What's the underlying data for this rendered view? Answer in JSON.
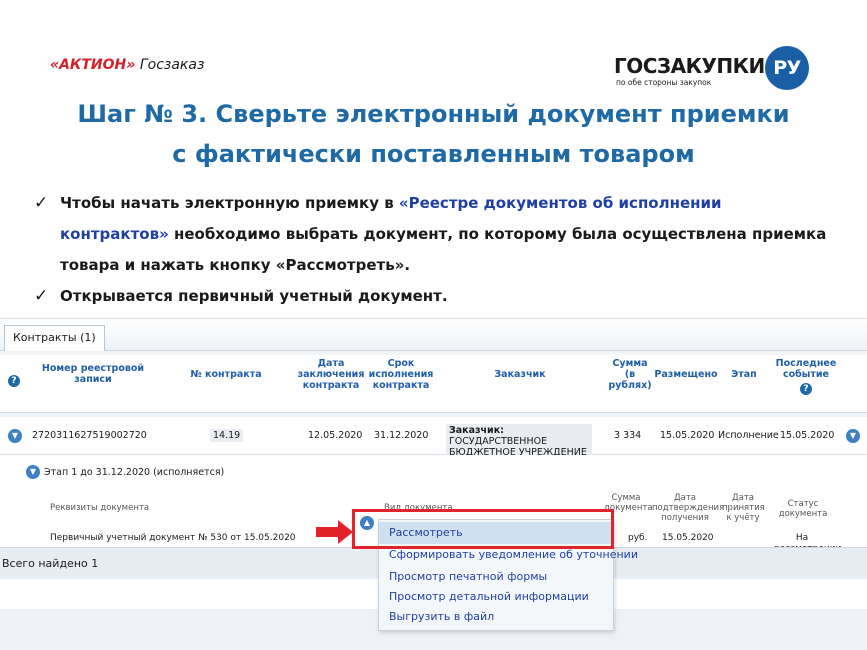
{
  "header": {
    "aktion_brand": "«АКТИОН»",
    "aktion_product": "Госзаказ",
    "gz_word": "ГОСЗАКУПКИ",
    "gz_circle": "РУ",
    "gz_tagline": "по обе стороны закупок"
  },
  "title": {
    "line1": "Шаг № 3. Сверьте электронный документ приемки",
    "line2": "с фактически поставленным товаром"
  },
  "bullets": {
    "b1_part1": "Чтобы начать электронную приемку в ",
    "b1_link": "«Реестре документов об исполнении контрактов»",
    "b1_part2": " необходимо выбрать документ, по которому была осуществлена приемка товара и нажать кнопку «Рассмотреть».",
    "b2": "Открывается первичный учетный документ."
  },
  "screenshot": {
    "tab_label": "Контракты (1)",
    "columns": {
      "reg_num": "Номер реестровой записи",
      "contract_num": "№ контракта",
      "conclusion_date": "Дата заключения контракта",
      "exec_term": "Срок исполнения контракта",
      "customer": "Заказчик",
      "sum": "Сумма (в рублях)",
      "placed": "Размещено",
      "stage": "Этап",
      "last_event": "Последнее событие"
    },
    "row": {
      "reg_num": "2720311627519002720",
      "contract_num": "14.19",
      "conclusion_date": "12.05.2020",
      "exec_term": "31.12.2020",
      "customer_label": "Заказчик:",
      "customer_value": "ГОСУДАРСТВЕННОЕ БЮДЖЕТНОЕ УЧРЕЖДЕНИЕ",
      "sum": "3 334",
      "placed": "15.05.2020",
      "stage": "Исполнение",
      "last_event": "15.05.2020"
    },
    "stage_line": "Этап 1 до 31.12.2020 (исполняется)",
    "doc_columns": {
      "requisites": "Реквизиты документа",
      "doc_type": "Вид документа",
      "doc_sum": "Сумма документа",
      "confirm_date": "Дата подтверждения получения",
      "accept_date": "Дата принятия к учёту",
      "status": "Статус документа"
    },
    "doc_row": {
      "requisites": "Первичный учетный документ № 530 от 15.05.2020",
      "currency": "руб.",
      "date": "15.05.2020",
      "status": "На рассмотрении"
    },
    "menu": [
      "Рассмотреть",
      "Сформировать уведомление об уточнении",
      "Просмотр печатной формы",
      "Просмотр детальной информации",
      "Выгрузить в файл"
    ],
    "total_found": "Всего найдено 1"
  },
  "colors": {
    "title_blue": "#1f6aa5",
    "link_blue": "#1f3fa6",
    "highlight_red": "#e3232a",
    "brand_red": "#d2232a"
  }
}
